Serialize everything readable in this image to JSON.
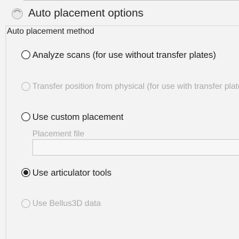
{
  "title": "Auto placement options",
  "group_label": "Auto placement method",
  "options": [
    {
      "label": "Analyze scans  (for use without transfer plates)",
      "checked": false,
      "enabled": true
    },
    {
      "label": "Transfer position from physical (for use with transfer plates)",
      "checked": false,
      "enabled": false
    },
    {
      "label": "Use custom placement",
      "checked": false,
      "enabled": true
    },
    {
      "label": "Use articulator tools",
      "checked": true,
      "enabled": true
    },
    {
      "label": "Use Bellus3D data",
      "checked": false,
      "enabled": false
    }
  ],
  "placement_file": {
    "label": "Placement file",
    "value": ""
  }
}
